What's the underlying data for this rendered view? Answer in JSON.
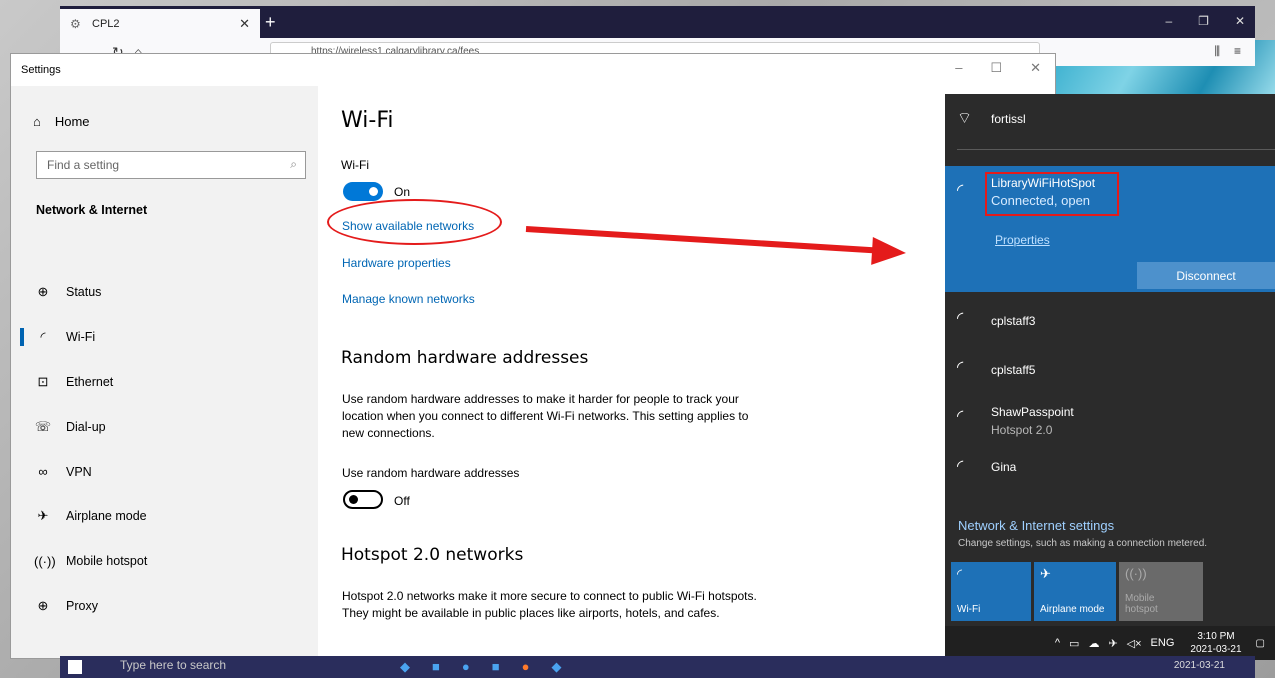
{
  "browser": {
    "tab_title": "CPL2",
    "new_tab": "+",
    "url": "https://wireless1.calgarylibrary.ca/fees",
    "win_min": "–",
    "win_max": "❐",
    "win_close": "✕"
  },
  "settings": {
    "window_title": "Settings",
    "home_label": "Home",
    "search_placeholder": "Find a setting",
    "section_label": "Network & Internet",
    "nav_items": [
      {
        "label": "Status",
        "icon": "globe-icon"
      },
      {
        "label": "Wi-Fi",
        "icon": "wifi-icon"
      },
      {
        "label": "Ethernet",
        "icon": "ethernet-icon"
      },
      {
        "label": "Dial-up",
        "icon": "dialup-icon"
      },
      {
        "label": "VPN",
        "icon": "vpn-icon"
      },
      {
        "label": "Airplane mode",
        "icon": "airplane-icon"
      },
      {
        "label": "Mobile hotspot",
        "icon": "hotspot-icon"
      },
      {
        "label": "Proxy",
        "icon": "globe-icon"
      }
    ],
    "page_title": "Wi-Fi",
    "wifi_label": "Wi-Fi",
    "wifi_state": "On",
    "links": {
      "show_networks": "Show available networks",
      "hardware_props": "Hardware properties",
      "manage_known": "Manage known networks"
    },
    "random_hw": {
      "title": "Random hardware addresses",
      "description": "Use random hardware addresses to make it harder for people to track your location when you connect to different Wi-Fi networks. This setting applies to new connections.",
      "toggle_label": "Use random hardware addresses",
      "toggle_state": "Off"
    },
    "hotspot20": {
      "title": "Hotspot 2.0 networks",
      "description": "Hotspot 2.0 networks make it more secure to connect to public Wi-Fi hotspots. They might be available in public places like airports, hotels, and cafes."
    }
  },
  "flyout": {
    "networks": [
      {
        "name": "fortissl",
        "sub": ""
      },
      {
        "name": "LibraryWiFiHotSpot",
        "sub": "Connected, open"
      },
      {
        "name": "cplstaff3",
        "sub": ""
      },
      {
        "name": "cplstaff5",
        "sub": ""
      },
      {
        "name": "ShawPasspoint",
        "sub": "Hotspot 2.0"
      },
      {
        "name": "Gina",
        "sub": ""
      }
    ],
    "properties_link": "Properties",
    "disconnect_label": "Disconnect",
    "footer_title": "Network & Internet settings",
    "footer_sub": "Change settings, such as making a connection metered.",
    "quick_actions": [
      {
        "label": "Wi-Fi",
        "icon": "wifi-icon"
      },
      {
        "label": "Airplane mode",
        "icon": "airplane-icon"
      },
      {
        "label": "Mobile hotspot",
        "icon": "hotspot-icon"
      }
    ]
  },
  "taskbar": {
    "language": "ENG",
    "time": "3:10 PM",
    "date": "2021-03-21",
    "search_text": "Type here to search"
  },
  "colors": {
    "accent": "#0078d7",
    "link": "#0066b4",
    "annotation": "#e41b1b",
    "flyout_bg": "#2b2b2b",
    "connected_bg": "#1e71b7"
  }
}
